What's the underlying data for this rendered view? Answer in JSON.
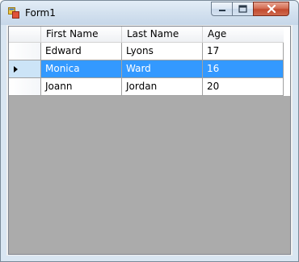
{
  "window": {
    "title": "Form1",
    "icon": "form-app-icon",
    "controls": [
      "minimize-icon",
      "maximize-icon",
      "close-icon"
    ]
  },
  "grid": {
    "columns": [
      "First Name",
      "Last Name",
      "Age"
    ],
    "rows": [
      {
        "first": "Edward",
        "last": "Lyons",
        "age": "17"
      },
      {
        "first": "Monica",
        "last": "Ward",
        "age": "16"
      },
      {
        "first": "Joann",
        "last": "Jordan",
        "age": "20"
      }
    ],
    "selected_row": 1,
    "colors": {
      "selection": "#3399ff",
      "empty_area": "#ababab",
      "row_header_selected": "#cce4f7"
    }
  }
}
